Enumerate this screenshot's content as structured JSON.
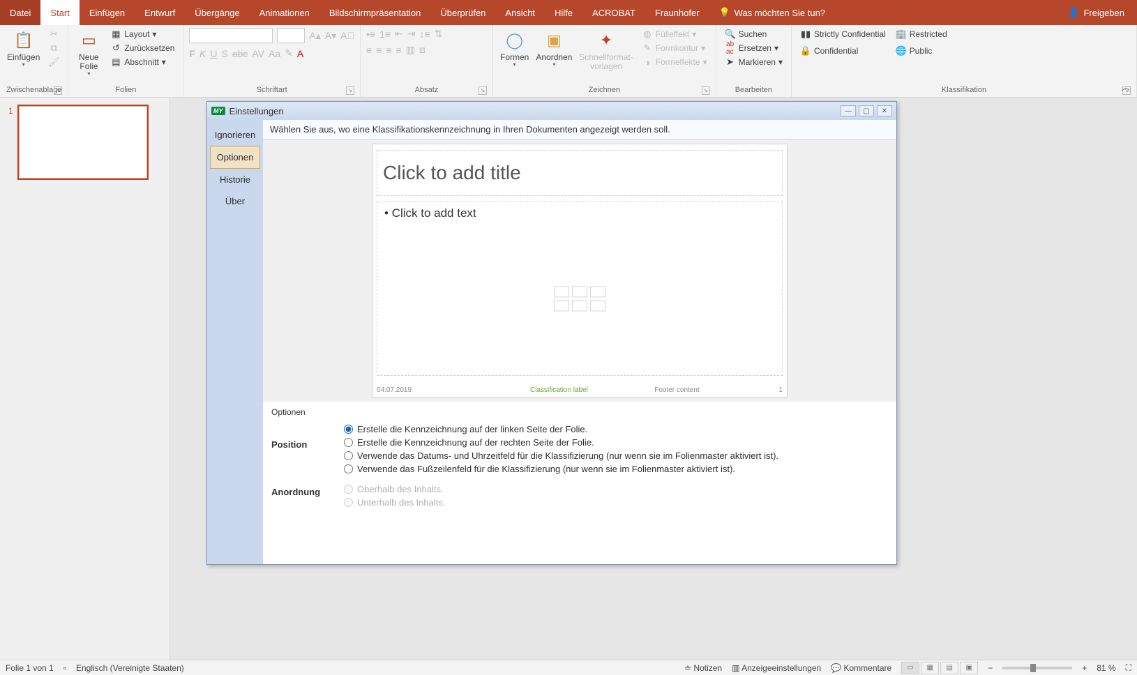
{
  "titlebar": {
    "tabs": [
      "Datei",
      "Start",
      "Einfügen",
      "Entwurf",
      "Übergänge",
      "Animationen",
      "Bildschirmpräsentation",
      "Überprüfen",
      "Ansicht",
      "Hilfe",
      "ACROBAT",
      "Fraunhofer"
    ],
    "active_tab": "Start",
    "search_prompt": "Was möchten Sie tun?",
    "share": "Freigeben"
  },
  "ribbon": {
    "clipboard": {
      "paste": "Einfügen",
      "label": "Zwischenablage"
    },
    "slides": {
      "new_slide_l1": "Neue",
      "new_slide_l2": "Folie",
      "layout": "Layout",
      "reset": "Zurücksetzen",
      "section": "Abschnitt",
      "label": "Folien"
    },
    "font": {
      "label": "Schriftart"
    },
    "paragraph": {
      "label": "Absatz"
    },
    "drawing": {
      "shapes": "Formen",
      "arrange": "Anordnen",
      "quick_l1": "Schnellformat-",
      "quick_l2": "vorlagen",
      "fill": "Fülleffekt",
      "outline": "Formkontur",
      "effects": "Formeffekte",
      "label": "Zeichnen"
    },
    "editing": {
      "find": "Suchen",
      "replace": "Ersetzen",
      "select": "Markieren",
      "label": "Bearbeiten"
    },
    "classification": {
      "strictly": "Strictly Confidential",
      "confidential": "Confidential",
      "restricted": "Restricted",
      "public": "Public",
      "label": "Klassifikation"
    }
  },
  "thumbs": {
    "num": "1"
  },
  "dialog": {
    "title": "Einstellungen",
    "logo": "MY",
    "side": {
      "ignore": "Ignorieren",
      "options": "Optionen",
      "history": "Historie",
      "about": "Über"
    },
    "hint": "Wählen Sie aus, wo eine Klassifikationskennzeichnung in Ihren Dokumenten angezeigt werden soll.",
    "preview": {
      "title_ph": "Click to add title",
      "body_ph": "• Click to add text",
      "date": "04.07.2019",
      "class_label": "Classification label",
      "footer": "Footer content",
      "page": "1"
    },
    "options": {
      "legend": "Optionen",
      "position_label": "Position",
      "pos1": "Erstelle die Kennzeichnung auf der linken Seite der Folie.",
      "pos2": "Erstelle die Kennzeichnung auf der rechten Seite der Folie.",
      "pos3": "Verwende das Datums- und Uhrzeitfeld für die Klassifizierung (nur wenn sie im Folienmaster aktiviert ist).",
      "pos4": "Verwende das Fußzeilenfeld für die Klassifizierung (nur wenn sie im Folienmaster aktiviert ist).",
      "order_label": "Anordnung",
      "order1": "Oberhalb des Inhalts.",
      "order2": "Unterhalb des Inhalts."
    }
  },
  "statusbar": {
    "slide_info": "Folie 1 von 1",
    "language": "Englisch (Vereinigte Staaten)",
    "notes": "Notizen",
    "display": "Anzeigeeinstellungen",
    "comments": "Kommentare",
    "zoom": "81 %"
  }
}
